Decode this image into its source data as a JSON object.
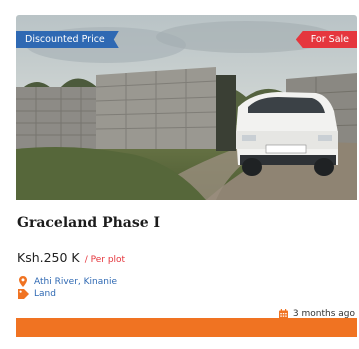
{
  "listing": {
    "badge_discount": "Discounted Price",
    "badge_status": "For Sale",
    "title": "Graceland Phase I",
    "price": "Ksh.250 K",
    "price_unit": "/ Per plot",
    "location": "Athi River, Kinanie",
    "property_type": "Land",
    "posted": "3 months ago"
  },
  "icons": {
    "location": "map-pin-icon",
    "type": "tag-icon",
    "date": "calendar-icon"
  },
  "colors": {
    "badge_discount": "#2f69b3",
    "badge_status": "#e5363d",
    "link_blue": "#2f69b3",
    "accent_orange": "#f07322"
  }
}
